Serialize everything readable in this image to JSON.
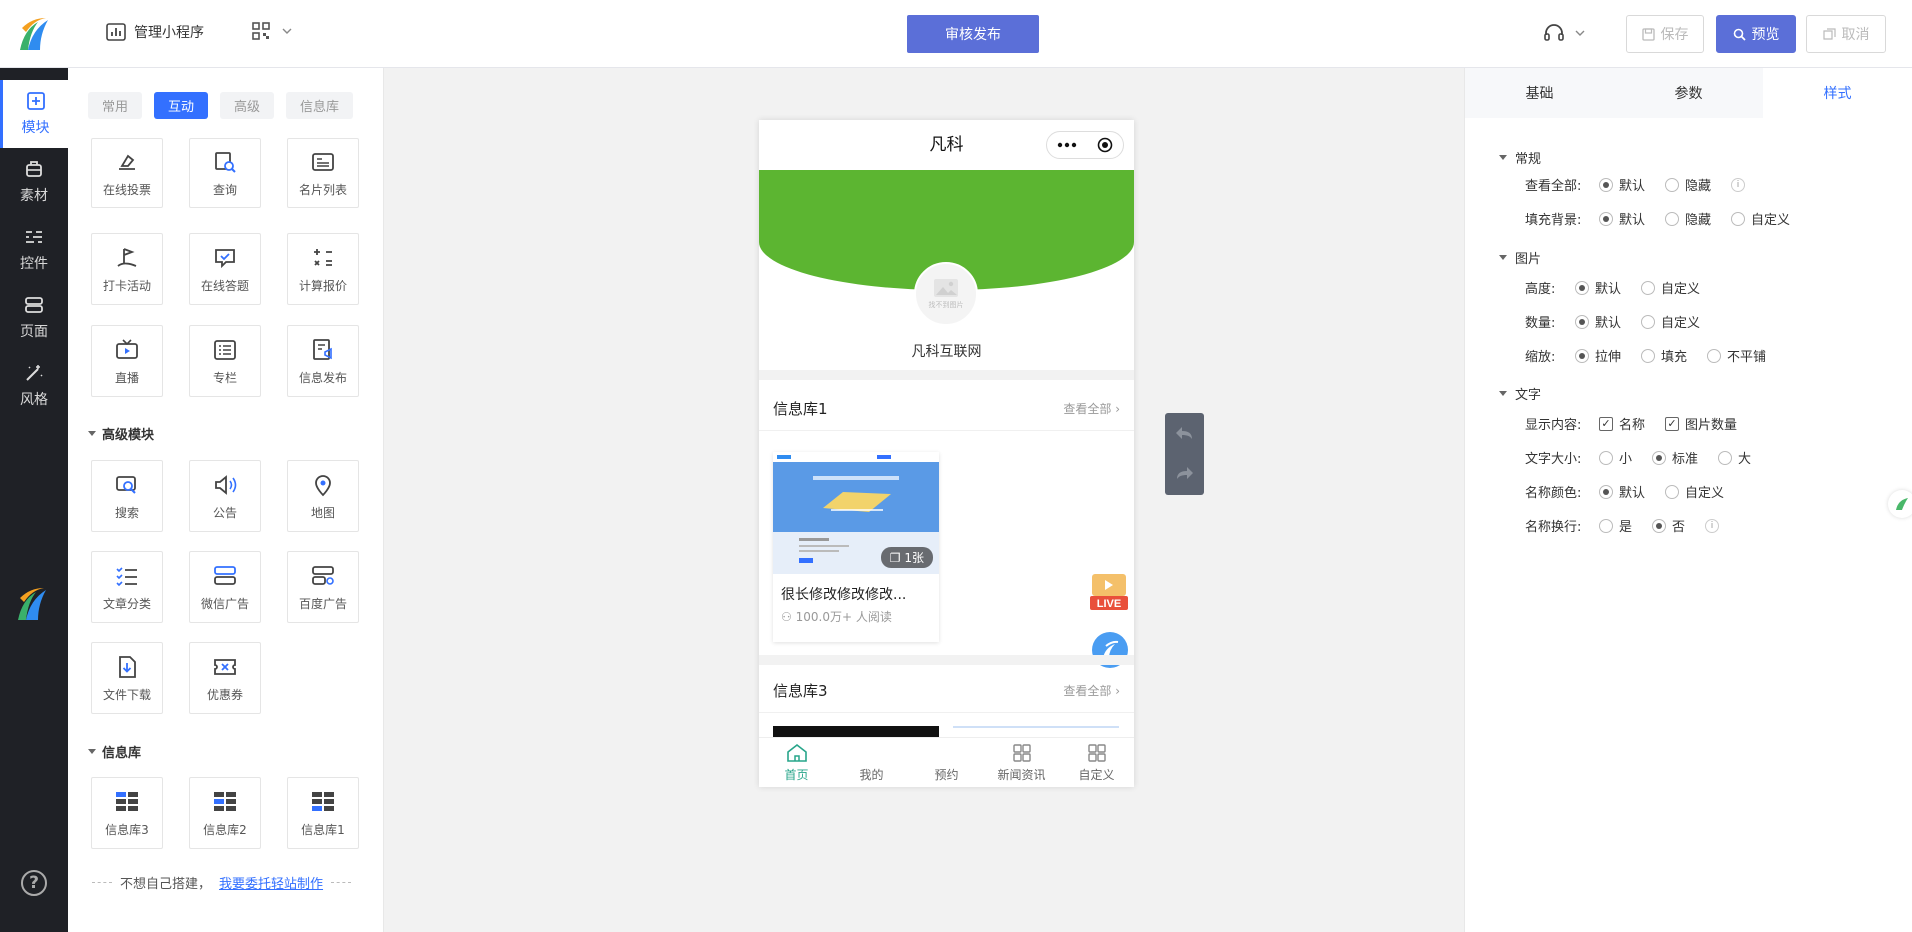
{
  "topbar": {
    "manage_label": "管理小程序",
    "publish_label": "审核发布",
    "save_label": "保存",
    "preview_label": "预览",
    "cancel_label": "取消"
  },
  "leftnav": {
    "items": [
      {
        "label": "模块",
        "icon": "plus-square-icon",
        "active": true
      },
      {
        "label": "素材",
        "icon": "material-icon"
      },
      {
        "label": "控件",
        "icon": "sliders-icon"
      },
      {
        "label": "页面",
        "icon": "page-icon"
      },
      {
        "label": "风格",
        "icon": "magic-wand-icon"
      }
    ],
    "help": "?"
  },
  "panel": {
    "tabs": [
      "常用",
      "互动",
      "高级",
      "信息库"
    ],
    "active_tab": "互动",
    "interactive_modules": [
      {
        "label": "在线投票",
        "icon": "vote-icon"
      },
      {
        "label": "查询",
        "icon": "query-icon"
      },
      {
        "label": "名片列表",
        "icon": "card-list-icon"
      },
      {
        "label": "打卡活动",
        "icon": "checkin-flag-icon"
      },
      {
        "label": "在线答题",
        "icon": "quiz-icon"
      },
      {
        "label": "计算报价",
        "icon": "calculator-icon"
      },
      {
        "label": "直播",
        "icon": "tv-icon"
      },
      {
        "label": "专栏",
        "icon": "column-icon"
      },
      {
        "label": "信息发布",
        "icon": "publish-info-icon"
      }
    ],
    "advanced_title": "高级模块",
    "advanced_modules": [
      {
        "label": "搜索",
        "icon": "search-icon"
      },
      {
        "label": "公告",
        "icon": "speaker-icon"
      },
      {
        "label": "地图",
        "icon": "map-pin-icon"
      },
      {
        "label": "文章分类",
        "icon": "list-check-icon"
      },
      {
        "label": "微信广告",
        "icon": "wechat-ad-icon"
      },
      {
        "label": "百度广告",
        "icon": "baidu-ad-icon"
      },
      {
        "label": "文件下载",
        "icon": "download-file-icon"
      },
      {
        "label": "优惠券",
        "icon": "coupon-icon"
      }
    ],
    "library_title": "信息库",
    "library_modules": [
      {
        "label": "信息库3",
        "icon": "grid-library-icon"
      },
      {
        "label": "信息库2",
        "icon": "grid-library-icon"
      },
      {
        "label": "信息库1",
        "icon": "grid-library-icon"
      }
    ],
    "footer_text": "不想自己搭建，",
    "footer_link": "我要委托轻站制作"
  },
  "phone": {
    "title": "凡科",
    "avatar_text": "找不到图片",
    "shop_name": "凡科互联网",
    "lib1": {
      "title": "信息库1",
      "view_all": "查看全部",
      "card_title": "很长修改修改修改...",
      "card_badge": "1张",
      "card_meta": "100.0万+ 人阅读"
    },
    "lib3": {
      "title": "信息库3",
      "view_all": "查看全部"
    },
    "live_label": "LIVE",
    "tabbar": [
      "首页",
      "我的",
      "预约",
      "新闻资讯",
      "自定义"
    ],
    "active_tab": "首页"
  },
  "right": {
    "tabs": [
      "基础",
      "参数",
      "样式"
    ],
    "active_tab": "样式",
    "sections": {
      "general": "常规",
      "image": "图片",
      "text": "文字"
    },
    "rows": {
      "view_all": {
        "label": "查看全部:",
        "options": [
          "默认",
          "隐藏"
        ],
        "selected": "默认"
      },
      "fill_bg": {
        "label": "填充背景:",
        "options": [
          "默认",
          "隐藏",
          "自定义"
        ],
        "selected": "默认"
      },
      "height": {
        "label": "高度:",
        "options": [
          "默认",
          "自定义"
        ],
        "selected": "默认"
      },
      "count": {
        "label": "数量:",
        "options": [
          "默认",
          "自定义"
        ],
        "selected": "默认"
      },
      "scale": {
        "label": "缩放:",
        "options": [
          "拉伸",
          "填充",
          "不平铺"
        ],
        "selected": "拉伸"
      },
      "display": {
        "label": "显示内容:",
        "options": [
          "名称",
          "图片数量"
        ],
        "checked": [
          "名称",
          "图片数量"
        ]
      },
      "font_size": {
        "label": "文字大小:",
        "options": [
          "小",
          "标准",
          "大"
        ],
        "selected": "标准"
      },
      "name_color": {
        "label": "名称颜色:",
        "options": [
          "默认",
          "自定义"
        ],
        "selected": "默认"
      },
      "name_wrap": {
        "label": "名称换行:",
        "options": [
          "是",
          "否"
        ],
        "selected": "否"
      }
    }
  },
  "colors": {
    "primary": "#3370ff",
    "publish": "#5b6fd8",
    "banner": "#5cb531",
    "tab_active": "#27a58a"
  }
}
